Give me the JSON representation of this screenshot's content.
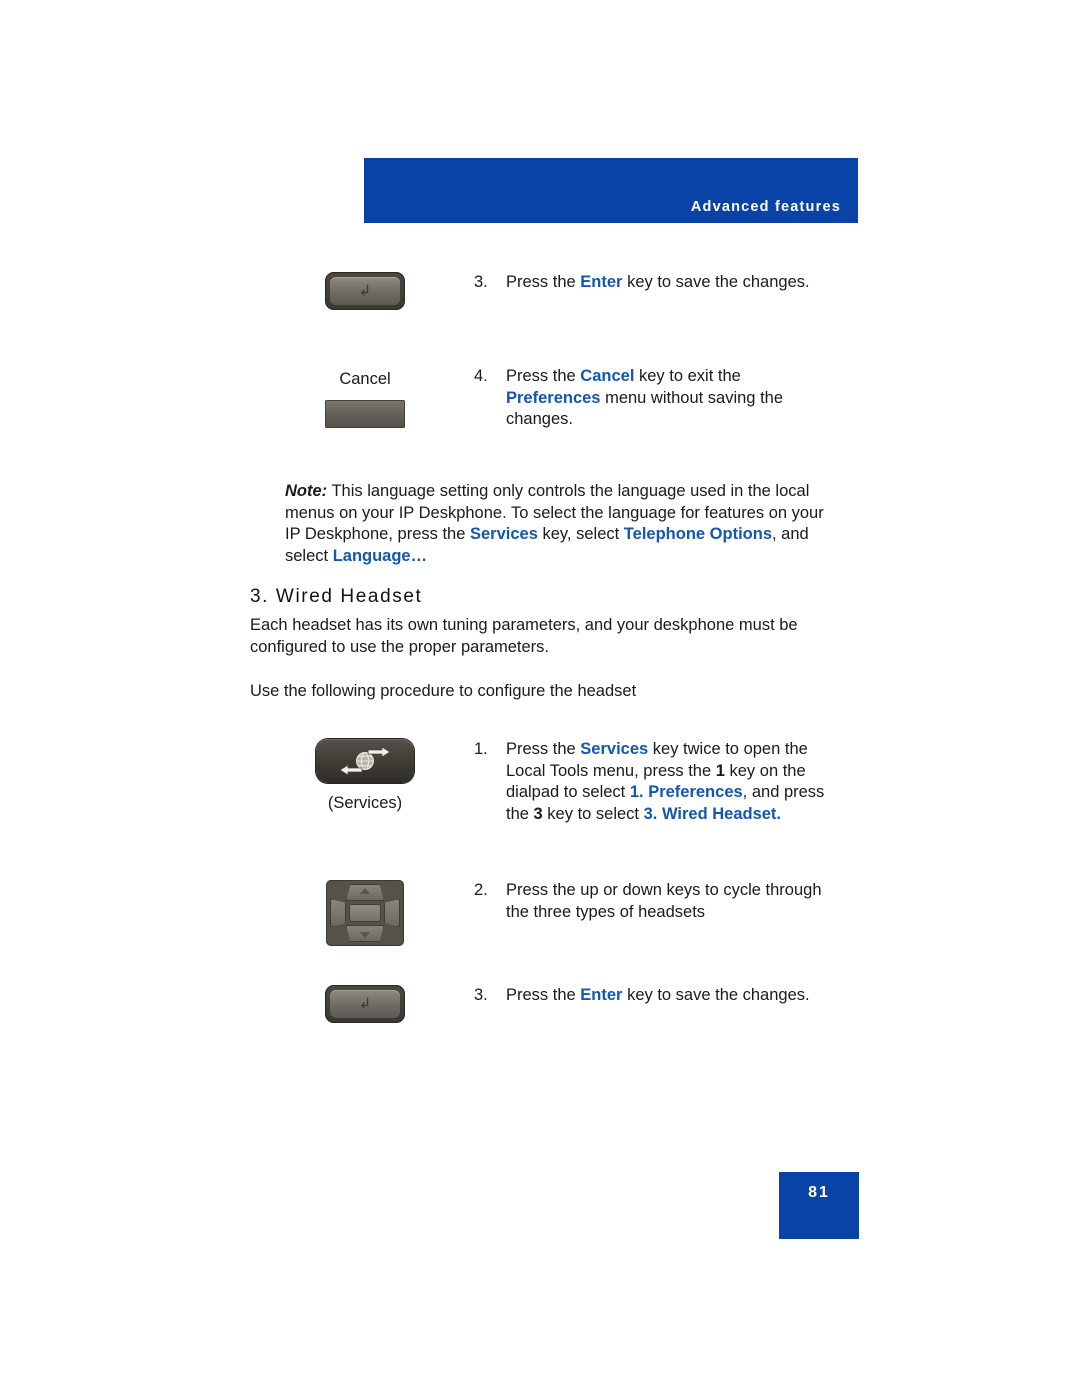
{
  "header": {
    "title": "Advanced features"
  },
  "steps_top": [
    {
      "number": "3.",
      "icon": "enter-key",
      "icon_glyph": "↲",
      "caption": "",
      "text_parts": [
        {
          "text": "Press the ",
          "style": "plain"
        },
        {
          "text": "Enter",
          "style": "blue-bold"
        },
        {
          "text": " key to save the changes.",
          "style": "plain"
        }
      ]
    },
    {
      "number": "4.",
      "icon": "cancel-softkey",
      "icon_glyph": "",
      "caption": "Cancel",
      "text_parts": [
        {
          "text": "Press the ",
          "style": "plain"
        },
        {
          "text": "Cancel",
          "style": "blue-bold"
        },
        {
          "text": " key to exit the ",
          "style": "plain"
        },
        {
          "text": "Preferences",
          "style": "blue-bold"
        },
        {
          "text": " menu without saving the changes.",
          "style": "plain"
        }
      ]
    }
  ],
  "note": {
    "lead": "Note:",
    "parts": [
      {
        "text": " This language setting only controls the language used in the local menus on your IP Deskphone. To select the language for features on your IP Deskphone, press the ",
        "style": "plain"
      },
      {
        "text": "Services",
        "style": "blue-bold"
      },
      {
        "text": " key, select ",
        "style": "plain"
      },
      {
        "text": "Telephone Options",
        "style": "blue-bold"
      },
      {
        "text": ", and select ",
        "style": "plain"
      },
      {
        "text": "Language…",
        "style": "blue-bold"
      }
    ]
  },
  "section": {
    "heading": "3. Wired Headset",
    "paragraph1": "Each headset has its own tuning parameters, and your deskphone must be configured to use the proper parameters.",
    "paragraph2": "Use the following procedure to configure the headset"
  },
  "steps_bottom": [
    {
      "number": "1.",
      "icon": "services-key",
      "caption": "(Services)",
      "text_parts": [
        {
          "text": "Press the ",
          "style": "plain"
        },
        {
          "text": "Services",
          "style": "blue-bold"
        },
        {
          "text": " key twice to open the Local Tools menu, press the ",
          "style": "plain"
        },
        {
          "text": "1",
          "style": "bold"
        },
        {
          "text": " key on the dialpad to select ",
          "style": "plain"
        },
        {
          "text": "1. Preferences",
          "style": "blue-bold"
        },
        {
          "text": ", and press the ",
          "style": "plain"
        },
        {
          "text": "3",
          "style": "bold"
        },
        {
          "text": " key to select ",
          "style": "plain"
        },
        {
          "text": "3. Wired Headset.",
          "style": "blue-bold"
        }
      ]
    },
    {
      "number": "2.",
      "icon": "navigation-key",
      "caption": "",
      "text_parts": [
        {
          "text": "Press the up or down keys to cycle through the three types of headsets",
          "style": "plain"
        }
      ]
    },
    {
      "number": "3.",
      "icon": "enter-key",
      "icon_glyph": "↲",
      "caption": "",
      "text_parts": [
        {
          "text": "Press the ",
          "style": "plain"
        },
        {
          "text": "Enter",
          "style": "blue-bold"
        },
        {
          "text": " key to save the changes.",
          "style": "plain"
        }
      ]
    }
  ],
  "footer": {
    "page_number": "81"
  },
  "colors": {
    "accent_blue": "#0a43a8",
    "text_blue": "#1456b0"
  }
}
